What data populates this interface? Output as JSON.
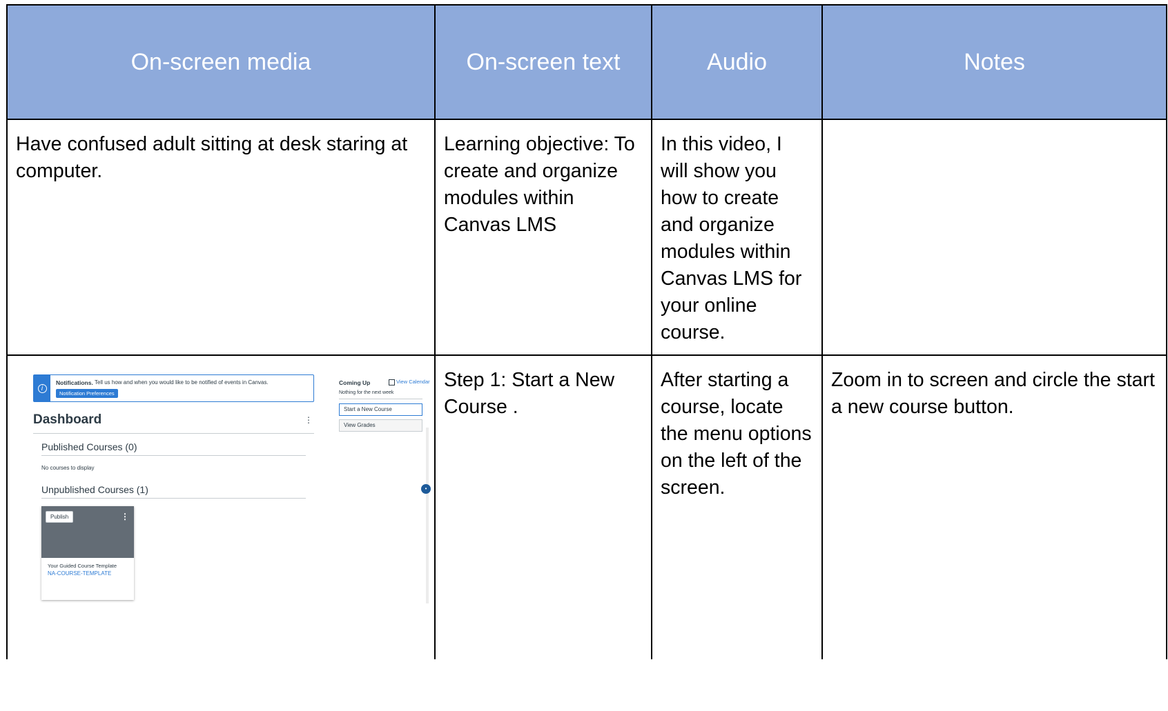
{
  "headers": [
    "On-screen media",
    "On-screen text",
    "Audio",
    "Notes"
  ],
  "rows": [
    {
      "media": "Have confused adult sitting at desk staring at computer.",
      "text": "Learning objective: To create and organize modules within Canvas LMS",
      "audio": "In this video, I will show you how to create and organize modules within Canvas LMS for your online course.",
      "notes": ""
    },
    {
      "media": "",
      "text": "Step 1: Start a New Course .",
      "audio": "After starting a course, locate the menu options on the left of the screen.",
      "notes": "Zoom in to screen and circle the start a new course button."
    }
  ],
  "canvas_screenshot": {
    "notification_title": "Notifications.",
    "notification_text": "Tell us how and when you would like to be notified of events in Canvas.",
    "notification_button": "Notification Preferences",
    "dashboard_title": "Dashboard",
    "published_heading": "Published Courses (0)",
    "no_courses": "No courses to display",
    "unpublished_heading": "Unpublished Courses (1)",
    "card_publish": "Publish",
    "card_name": "Your Guided Course Template",
    "card_code": "NA-COURSE-TEMPLATE",
    "coming_up": "Coming Up",
    "view_calendar": "View Calendar",
    "nothing_next": "Nothing for the next week",
    "start_new_course": "Start a New Course",
    "view_grades": "View Grades",
    "icons": [
      "info-icon",
      "kebab-icon",
      "calendar-icon"
    ],
    "accent_color": "#2d7bd4"
  }
}
